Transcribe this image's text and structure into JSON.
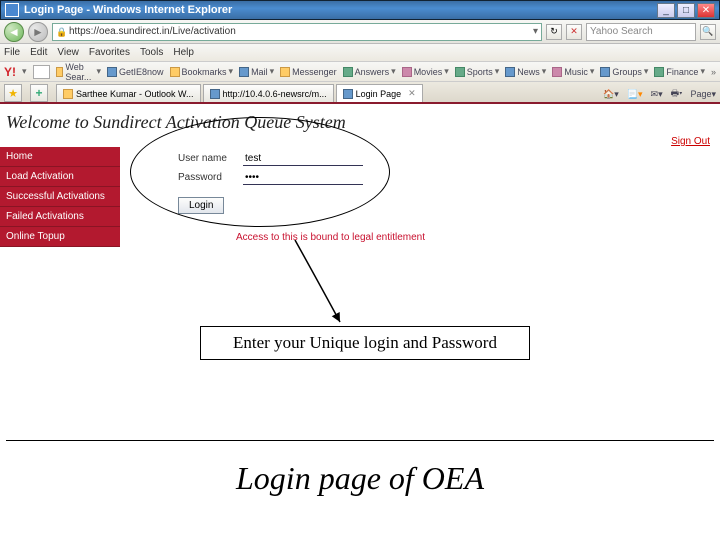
{
  "window": {
    "title": "Login Page - Windows Internet Explorer"
  },
  "nav": {
    "url": "https://oea.sundirect.in/Live/activation",
    "search_placeholder": "Yahoo Search"
  },
  "menu": {
    "items": [
      "File",
      "Edit",
      "View",
      "Favorites",
      "Tools",
      "Help"
    ]
  },
  "ytb": {
    "search_btn": "Web Sear...",
    "items": [
      "GetIE8now",
      "Bookmarks",
      "Mail",
      "Messenger",
      "Answers",
      "Movies",
      "Sports",
      "News",
      "Music",
      "Groups",
      "Finance"
    ]
  },
  "tabs": {
    "list": [
      {
        "label": "Sarthee Kumar - Outlook W..."
      },
      {
        "label": "http://10.4.0.6-newsrc/m..."
      },
      {
        "label": "Login Page"
      }
    ],
    "cmd": {
      "home": "",
      "feeds": "",
      "print": "",
      "page": "Page",
      "safety": ""
    }
  },
  "page": {
    "heading": "Welcome to Sundirect Activation Queue System",
    "signout": "Sign Out",
    "sidebar": [
      "Home",
      "Load Activation",
      "Successful Activations",
      "Failed Activations",
      "Online Topup"
    ],
    "form": {
      "user_label": "User name",
      "user_value": "test",
      "pass_label": "Password",
      "pass_value": "••••",
      "login_btn": "Login"
    },
    "warn": "Access to this is bound to legal entitlement"
  },
  "callout": "Enter your Unique login and Password",
  "caption": "Login page of OEA"
}
